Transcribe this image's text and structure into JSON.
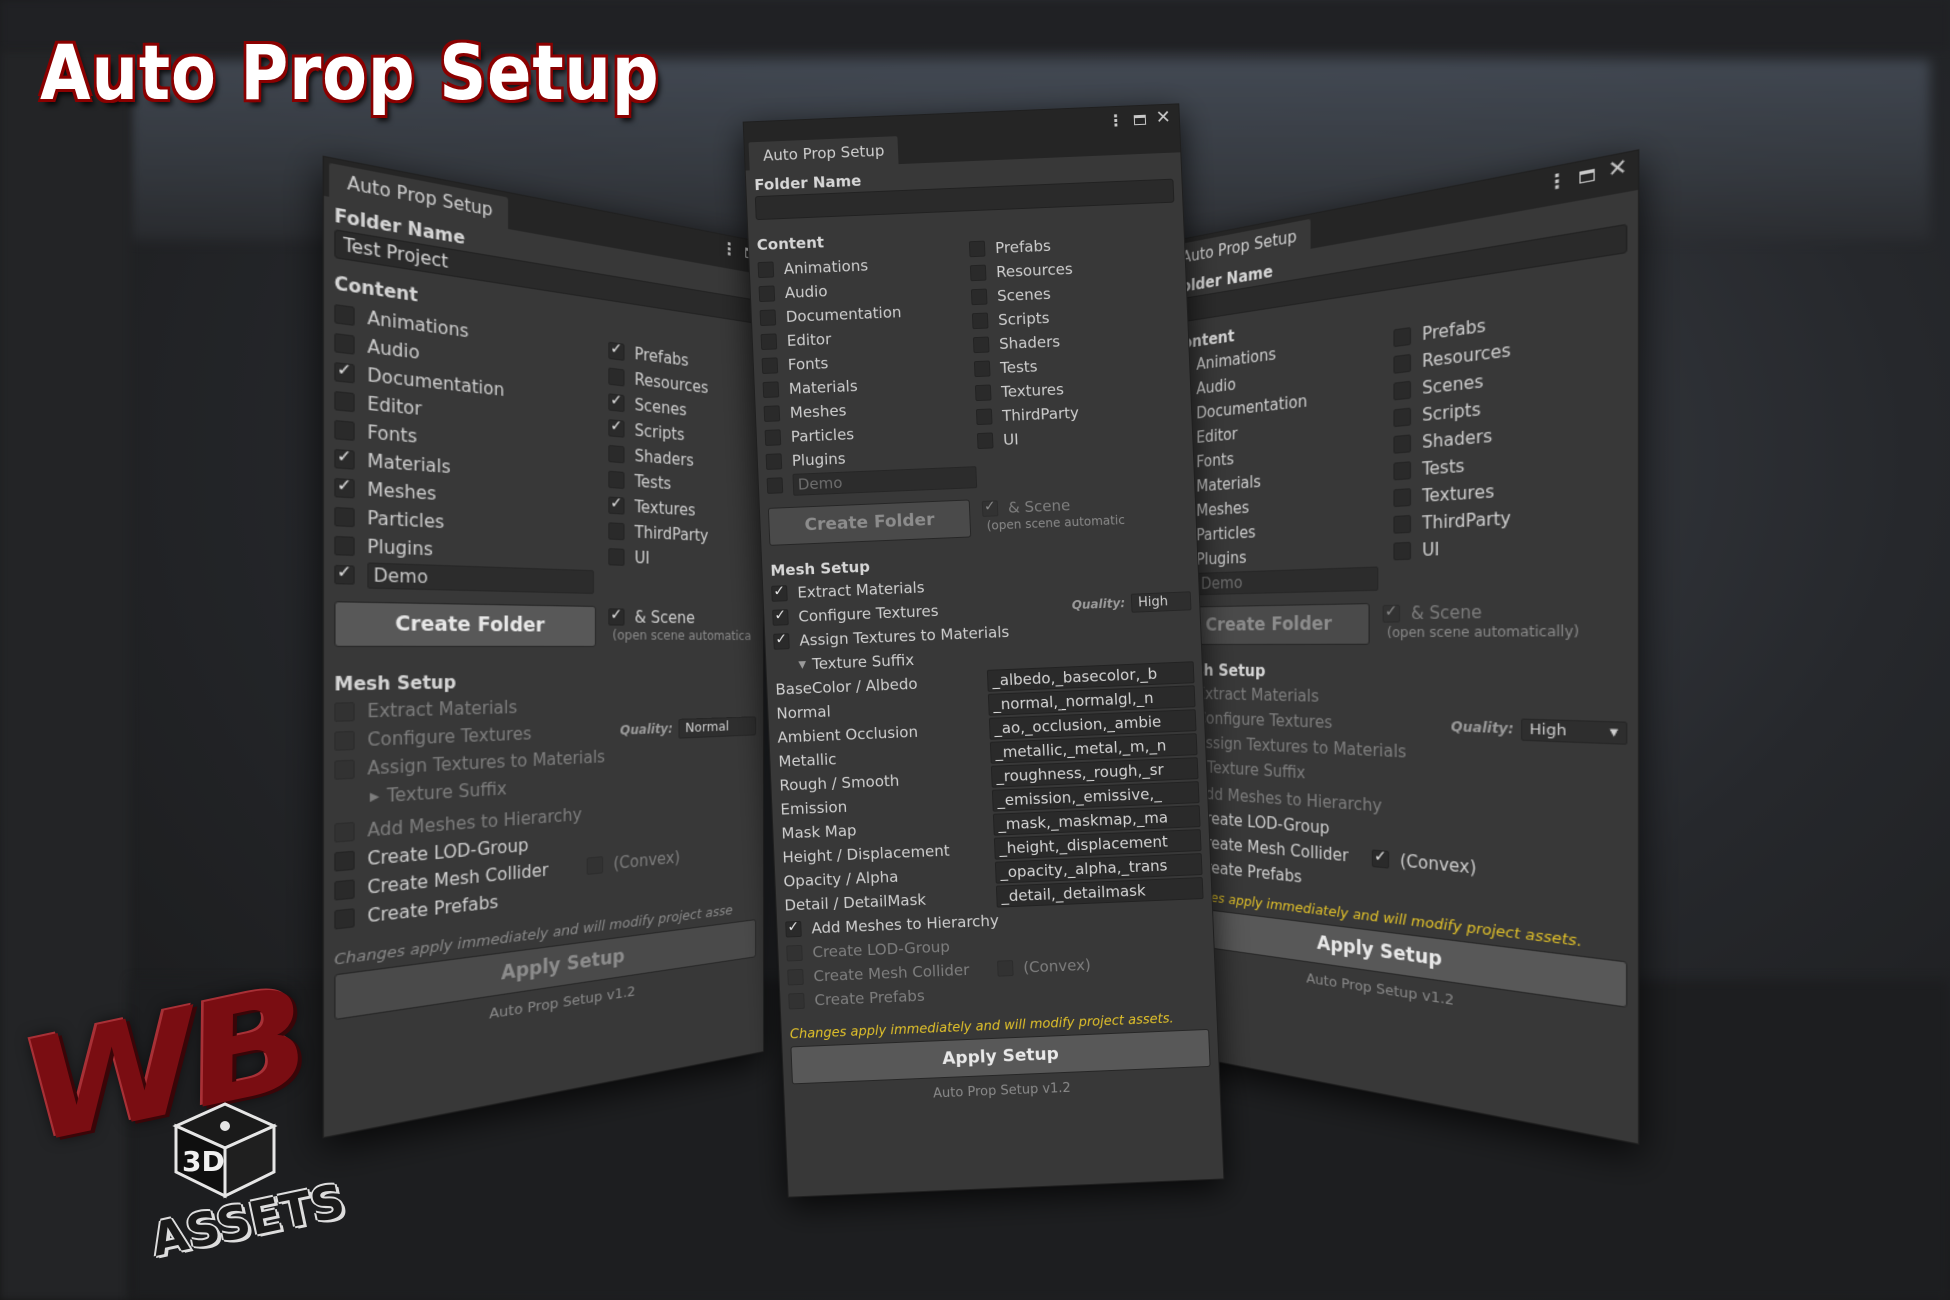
{
  "brand": {
    "title": "Auto Prop Setup",
    "logo_letters": "WB",
    "logo_cube": "3D",
    "logo_assets": "ASSETS"
  },
  "common": {
    "tab_title": "Auto Prop Setup",
    "folder_name_label": "Folder Name",
    "content_label": "Content",
    "create_folder": "Create Folder",
    "scene_label": "& Scene",
    "scene_hint_full": "(open scene automatically)",
    "scene_hint_cut": "(open scene automatica",
    "scene_hint_cut2": "(open scene automatic",
    "mesh_setup_label": "Mesh Setup",
    "extract_materials": "Extract Materials",
    "configure_textures": "Configure Textures",
    "quality_label": "Quality:",
    "assign_textures": "Assign Textures to Materials",
    "texture_suffix": "Texture Suffix",
    "add_meshes": "Add Meshes to Hierarchy",
    "create_lod": "Create LOD-Group",
    "create_mesh_collider": "Create Mesh Collider",
    "convex": "(Convex)",
    "create_prefabs": "Create Prefabs",
    "warning": "Changes apply immediately and will modify project assets.",
    "warning_cut": "Changes apply immediately and will modify project asse",
    "apply_setup": "Apply Setup",
    "version": "Auto Prop Setup v1.2",
    "demo": "Demo",
    "chevron_down": "▾",
    "arrow_down": "▼",
    "arrow_right": "▶",
    "close_glyph": "✕",
    "dots_glyph": "⋮",
    "content_left": [
      "Animations",
      "Audio",
      "Documentation",
      "Editor",
      "Fonts",
      "Materials",
      "Meshes",
      "Particles",
      "Plugins"
    ],
    "content_right": [
      "Prefabs",
      "Resources",
      "Scenes",
      "Scripts",
      "Shaders",
      "Tests",
      "Textures",
      "ThirdParty",
      "UI"
    ]
  },
  "left_panel": {
    "folder_value": "Test Project",
    "quality_value": "Normal",
    "left_checked": [
      false,
      false,
      true,
      false,
      false,
      true,
      true,
      false,
      false
    ],
    "right_checked": [
      true,
      false,
      true,
      true,
      false,
      false,
      true,
      false,
      false
    ]
  },
  "center_panel": {
    "folder_value": "",
    "quality_value": "High",
    "suffixes": [
      {
        "label": "BaseColor / Albedo",
        "value": "_albedo,_basecolor,_b"
      },
      {
        "label": "Normal",
        "value": "_normal,_normalgl,_n"
      },
      {
        "label": "Ambient Occlusion",
        "value": "_ao,_occlusion,_ambie"
      },
      {
        "label": "Metallic",
        "value": "_metallic,_metal,_m,_n"
      },
      {
        "label": "Rough / Smooth",
        "value": "_roughness,_rough,_sr"
      },
      {
        "label": "Emission",
        "value": "_emission,_emissive,_"
      },
      {
        "label": "Mask Map",
        "value": "_mask,_maskmap,_ma"
      },
      {
        "label": "Height / Displacement",
        "value": "_height,_displacement"
      },
      {
        "label": "Opacity / Alpha",
        "value": "_opacity,_alpha,_trans"
      },
      {
        "label": "Detail / DetailMask",
        "value": "_detail,_detailmask"
      }
    ]
  },
  "right_panel": {
    "folder_value": "",
    "quality_value": "High"
  },
  "colors": {
    "panel_bg": "#383838",
    "field_bg": "#2a2a2a",
    "warning": "#e2c22a",
    "brand_red": "#8a0000"
  }
}
